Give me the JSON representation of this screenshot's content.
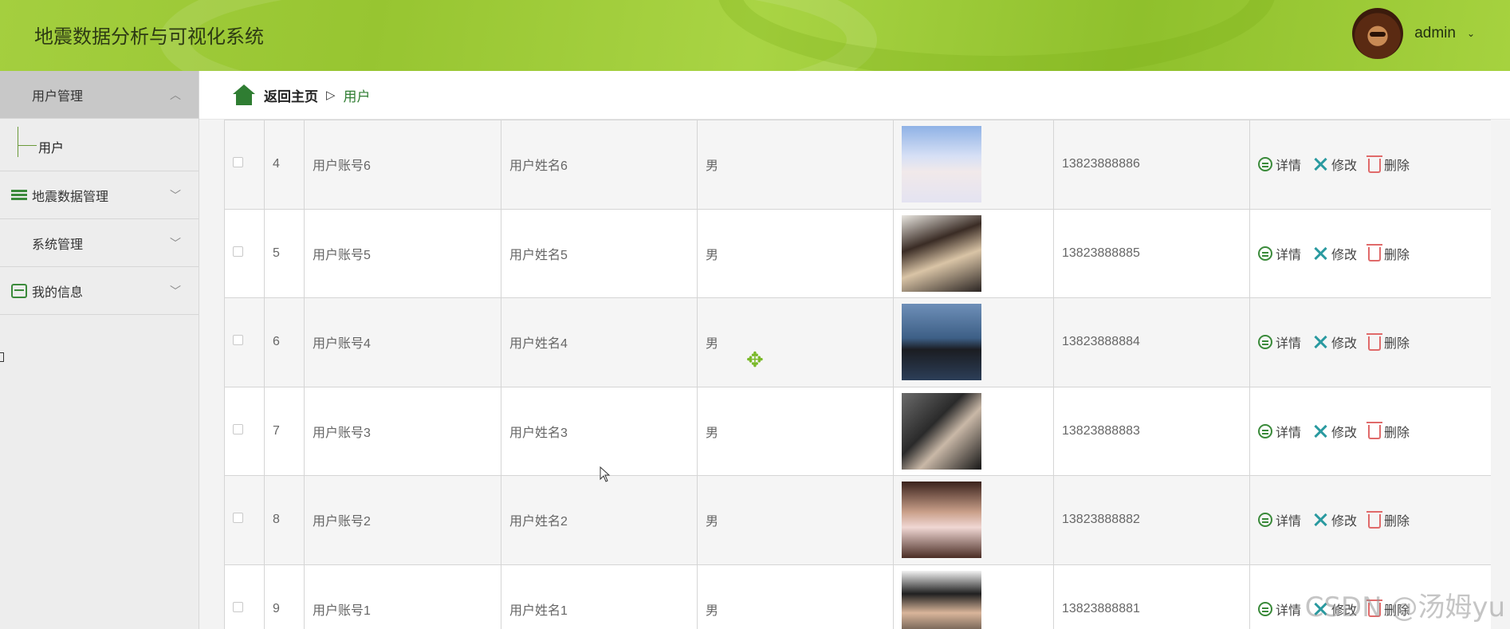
{
  "header": {
    "title": "地震数据分析与可视化系统",
    "username": "admin",
    "caret": "⌄"
  },
  "sidebar": {
    "groups": [
      {
        "label": "用户管理",
        "icon": "grid-icon",
        "expanded": true,
        "chevron": "︿"
      },
      {
        "label": "地震数据管理",
        "icon": "list-icon",
        "chevron": "﹀"
      },
      {
        "label": "系统管理",
        "icon": "grid-icon",
        "chevron": "﹀"
      },
      {
        "label": "我的信息",
        "icon": "card-icon",
        "chevron": "﹀"
      }
    ],
    "sub_items": [
      {
        "label": "用户"
      }
    ]
  },
  "breadcrumb": {
    "home": "返回主页",
    "separator": "▷",
    "current": "用户"
  },
  "table": {
    "rows": [
      {
        "index": "4",
        "account": "用户账号6",
        "name": "用户姓名6",
        "gender": "男",
        "photo": "photo-girl-white-sweater",
        "phone": "13823888886"
      },
      {
        "index": "5",
        "account": "用户账号5",
        "name": "用户姓名5",
        "gender": "男",
        "photo": "photo-girl-lying",
        "phone": "13823888885"
      },
      {
        "index": "6",
        "account": "用户账号4",
        "name": "用户姓名4",
        "gender": "男",
        "photo": "photo-man-sea",
        "phone": "13823888884"
      },
      {
        "index": "7",
        "account": "用户账号3",
        "name": "用户姓名3",
        "gender": "男",
        "photo": "photo-man-phone-booth",
        "phone": "13823888883"
      },
      {
        "index": "8",
        "account": "用户账号2",
        "name": "用户姓名2",
        "gender": "男",
        "photo": "photo-girl-mask",
        "phone": "13823888882"
      },
      {
        "index": "9",
        "account": "用户账号1",
        "name": "用户姓名1",
        "gender": "男",
        "photo": "photo-boy-cap",
        "phone": "13823888881"
      }
    ],
    "actions": {
      "detail": "详情",
      "edit": "修改",
      "delete": "删除"
    }
  },
  "watermark": "CSDN @汤姆yu",
  "colors": {
    "header_green": "#a4cf3f",
    "accent_green": "#2f7d32",
    "edit_teal": "#2a9aa0",
    "delete_red": "#e06a6a"
  }
}
